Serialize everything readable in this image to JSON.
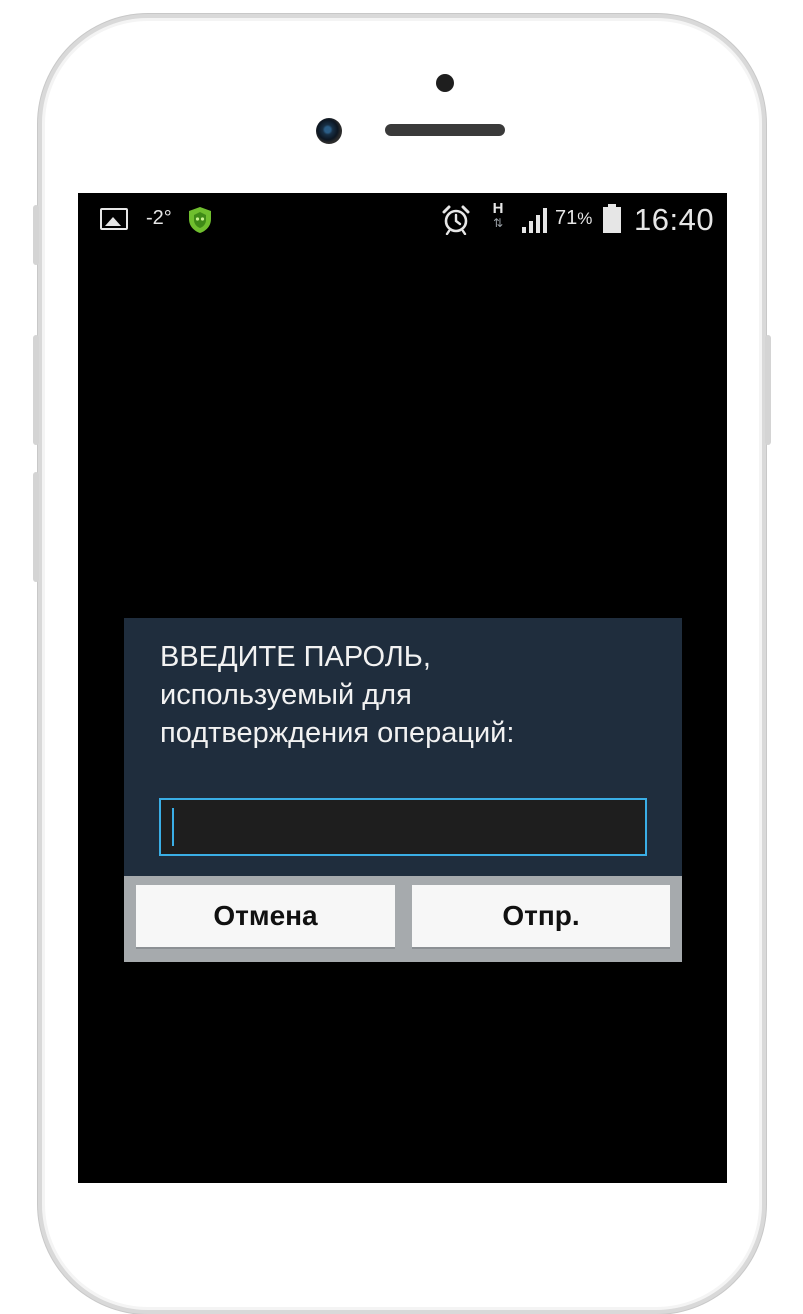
{
  "status_bar": {
    "temperature": "-2°",
    "network_type": "H",
    "network_arrows": "⇅",
    "battery_percent": "71",
    "percent_sign": "%",
    "time": "16:40",
    "icons": [
      "image-icon",
      "shield-app-icon",
      "alarm-icon",
      "signal-icon",
      "battery-icon"
    ]
  },
  "dialog": {
    "message": "ВВЕДИТЕ ПАРОЛЬ,\nиспользуемый  для\nподтверждения операций:",
    "password_value": "",
    "cancel_label": "Отмена",
    "send_label": "Отпр."
  },
  "colors": {
    "dialog_bg": "#1f2d3d",
    "input_border": "#3aaee6",
    "shield_green": "#6fbe2e"
  }
}
